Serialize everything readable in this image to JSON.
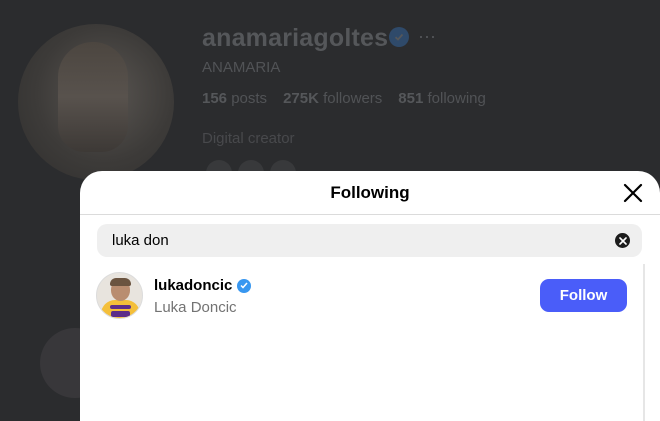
{
  "background_profile": {
    "username": "anamariagoltes",
    "more_icon": "ellipsis-icon",
    "full_name": "ANAMARIA",
    "stats": {
      "posts_count": "156",
      "posts_label": "posts",
      "followers_count": "275K",
      "followers_label": "followers",
      "following_count": "851",
      "following_label": "following"
    },
    "bio": "Digital creator"
  },
  "modal": {
    "title": "Following",
    "close_icon": "close-icon",
    "search": {
      "value": "luka don",
      "clear_icon": "clear-circle-icon"
    },
    "results": [
      {
        "username": "lukadoncic",
        "verified": true,
        "full_name": "Luka Doncic",
        "follow_label": "Follow"
      }
    ]
  },
  "colors": {
    "follow_button": "#4a5df9",
    "verified_badge": "#3897f0",
    "overlay": "#2b2c2e"
  }
}
